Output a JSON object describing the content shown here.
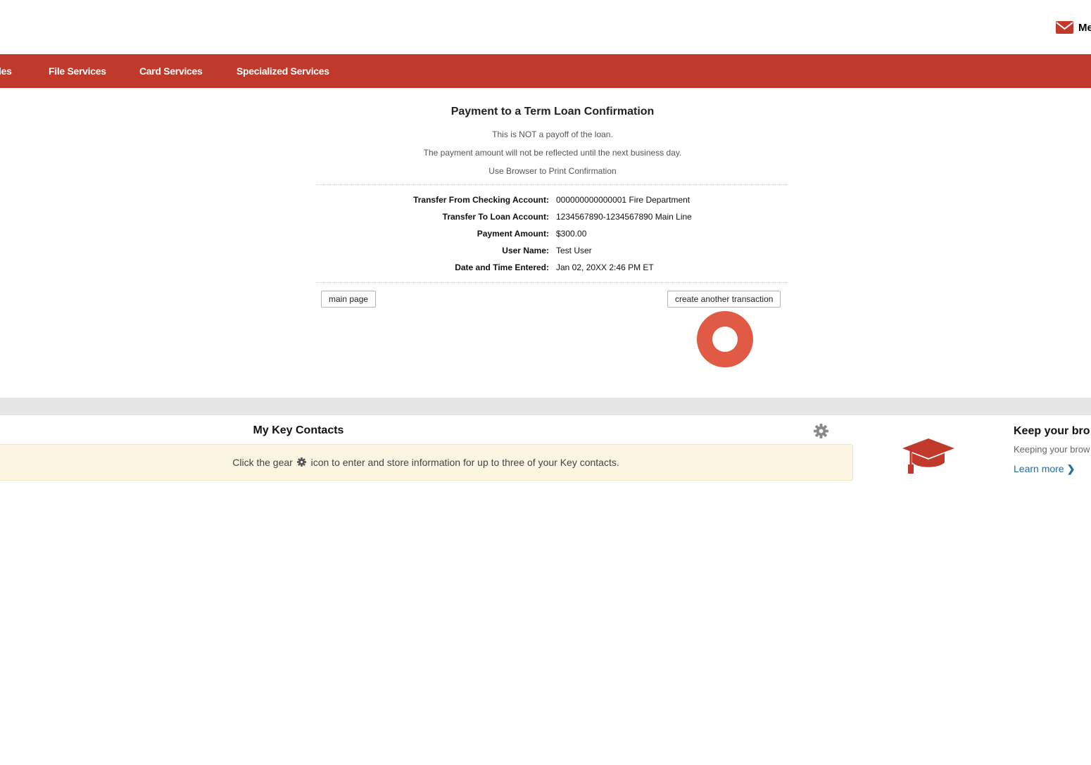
{
  "header": {
    "mail_label": "Me",
    "mail_icon": "envelope-icon"
  },
  "nav": {
    "items": [
      {
        "label": "les"
      },
      {
        "label": "File Services"
      },
      {
        "label": "Card Services"
      },
      {
        "label": "Specialized Services"
      }
    ]
  },
  "confirmation": {
    "title": "Payment to a Term Loan Confirmation",
    "notes": [
      "This is NOT a payoff of the loan.",
      "The payment amount will not be reflected until the next business day.",
      "Use Browser to Print Confirmation"
    ],
    "details": [
      {
        "label": "Transfer From Checking Account:",
        "value": "000000000000001 Fire Department"
      },
      {
        "label": "Transfer To Loan Account:",
        "value": "1234567890-1234567890 Main Line"
      },
      {
        "label": "Payment Amount:",
        "value": "$300.00"
      },
      {
        "label": "User Name:",
        "value": "Test User"
      },
      {
        "label": "Date and Time Entered:",
        "value": "Jan 02, 20XX 2:46 PM ET"
      }
    ],
    "main_page_button": "main page",
    "create_another_button": "create another transaction"
  },
  "key_contacts": {
    "title": "My Key Contacts",
    "message_before": "Click the gear",
    "message_after": "icon to enter and store information for up to three of your Key contacts.",
    "settings_icon": "gear-icon"
  },
  "promo": {
    "title": "Keep your bro",
    "subtitle": "Keeping your brow",
    "link": "Learn more",
    "icon": "graduation-cap-icon"
  },
  "colors": {
    "brand": "#c0392b",
    "click_marker": "#e05a45",
    "link": "#1f6fa8"
  }
}
